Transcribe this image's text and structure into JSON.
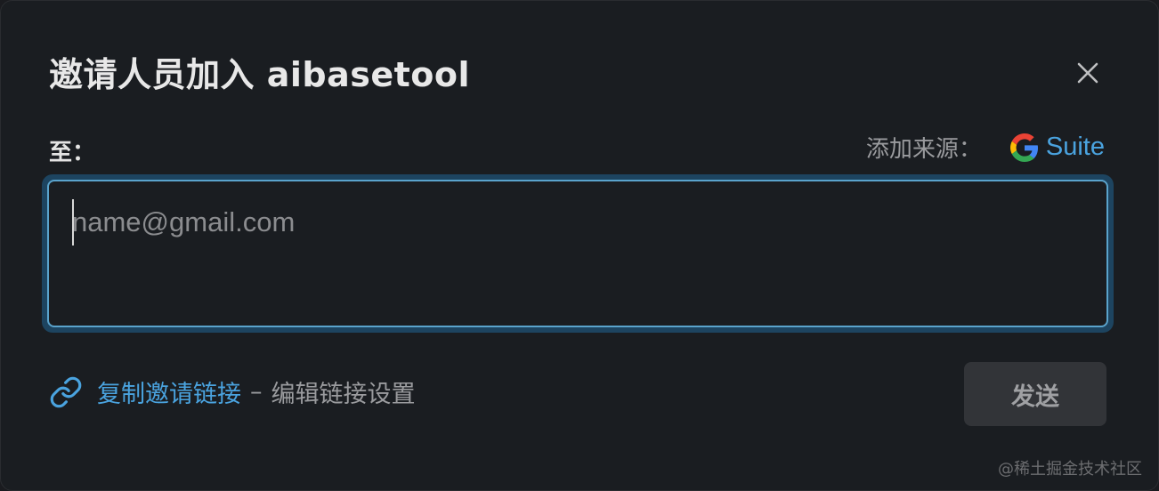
{
  "dialog": {
    "title": "邀请人员加入 aibasetool",
    "close_icon": "close-icon"
  },
  "recipient": {
    "label": "至：",
    "source_label": "添加来源：",
    "gsuite_text": "Suite",
    "gsuite_icon": "google-g-icon",
    "input_placeholder": "name@gmail.com",
    "input_value": ""
  },
  "footer": {
    "link_icon": "link-icon",
    "copy_link_label": "复制邀请链接",
    "separator": "–",
    "edit_settings_label": "编辑链接设置",
    "send_label": "发送"
  },
  "watermark": "@稀土掘金技术社区",
  "colors": {
    "background": "#1a1d21",
    "accent": "#4aa3df",
    "input_border": "#5aa3cc",
    "button_bg": "#323438",
    "muted_text": "#9a9b9e"
  }
}
